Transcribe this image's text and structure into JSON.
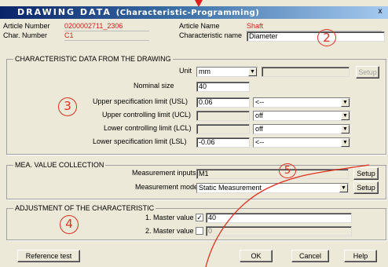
{
  "window": {
    "title": "DRAWING DATA",
    "title_sub": "(Characteristic-Programming)",
    "close_label": "x"
  },
  "header": {
    "article_number_label": "Article Number",
    "article_number_value": "0200002711_2306",
    "char_number_label": "Char. Number",
    "char_number_value": "C1",
    "article_name_label": "Article Name",
    "article_name_value": "Shaft",
    "characteristic_name_label": "Characteristic name",
    "characteristic_name_value": "Diameter"
  },
  "drawing_group": {
    "title": "CHARACTERISTIC DATA FROM THE DRAWING",
    "unit_label": "Unit",
    "unit_value": "mm",
    "setup_label": "Setup",
    "nominal_label": "Nominal size",
    "nominal_value": "40",
    "usl_label": "Upper specification limit (USL)",
    "usl_value": "0.06",
    "usl_mode": "<--",
    "ucl_label": "Upper controlling limit (UCL)",
    "ucl_mode": "off",
    "lcl_label": "Lower controlling limit (LCL)",
    "lcl_mode": "off",
    "lsl_label": "Lower specification limit (LSL)",
    "lsl_value": "-0.06",
    "lsl_mode": "<--"
  },
  "mea_group": {
    "title": "MEA. VALUE COLLECTION",
    "inputs_label": "Measurement inputs",
    "inputs_value": "M1",
    "mode_label": "Measurement mode",
    "mode_value": "Static Measurement",
    "setup_label": "Setup"
  },
  "adjust_group": {
    "title": "ADJUSTMENT OF THE CHARACTERISTIC",
    "master1_label": "1. Master value",
    "master1_checked": "✓",
    "master1_value": "40",
    "master2_label": "2. Master value",
    "master2_value": "0"
  },
  "footer": {
    "reference_label": "Reference test",
    "ok_label": "OK",
    "cancel_label": "Cancel",
    "help_label": "Help"
  },
  "annotations": {
    "n2": "2",
    "n3": "3",
    "n4": "4",
    "n5": "5"
  },
  "colors": {
    "annotation": "#e03020",
    "title_gradient_start": "#0a246a",
    "title_gradient_end": "#a6caf0",
    "dialog_bg": "#ece9d8",
    "highlight_text": "#d02020"
  }
}
